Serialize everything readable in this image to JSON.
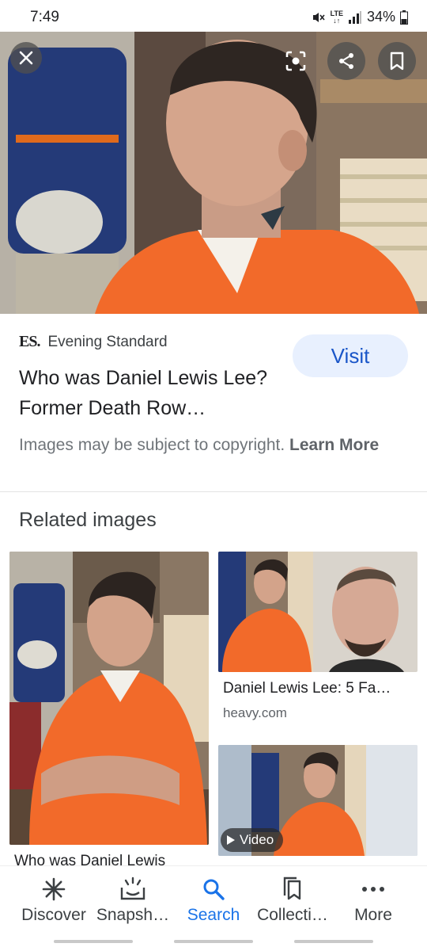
{
  "status": {
    "time": "7:49",
    "lte_top": "LTE",
    "lte_bottom": "↓↑",
    "battery": "34%"
  },
  "viewer": {
    "close_icon": "close-icon",
    "lens_icon": "lens-icon",
    "share_icon": "share-icon",
    "save_icon": "bookmark-icon"
  },
  "source": {
    "logo": "ES.",
    "name": "Evening Standard",
    "visit_label": "Visit"
  },
  "result": {
    "title": "Who was Daniel Lewis Lee? Former Death Row…",
    "copyright_text": "Images may be subject to copyright.",
    "learn_more": "Learn More"
  },
  "related": {
    "heading": "Related images",
    "items": [
      {
        "caption": "Who was Daniel Lewis"
      },
      {
        "caption": "Daniel Lewis Lee: 5 Fa…",
        "domain": "heavy.com"
      },
      {
        "badge": "Video"
      }
    ]
  },
  "nav": {
    "items": [
      {
        "label": "Discover",
        "icon": "asterisk-icon"
      },
      {
        "label": "Snapsh…",
        "icon": "snapshot-icon"
      },
      {
        "label": "Search",
        "icon": "search-icon"
      },
      {
        "label": "Collecti…",
        "icon": "collections-icon"
      },
      {
        "label": "More",
        "icon": "more-dots-icon"
      }
    ],
    "active": "Search"
  },
  "colors": {
    "accent": "#1a73e8",
    "visit_bg": "#e8f0fe",
    "jumpsuit": "#f26a2a"
  }
}
